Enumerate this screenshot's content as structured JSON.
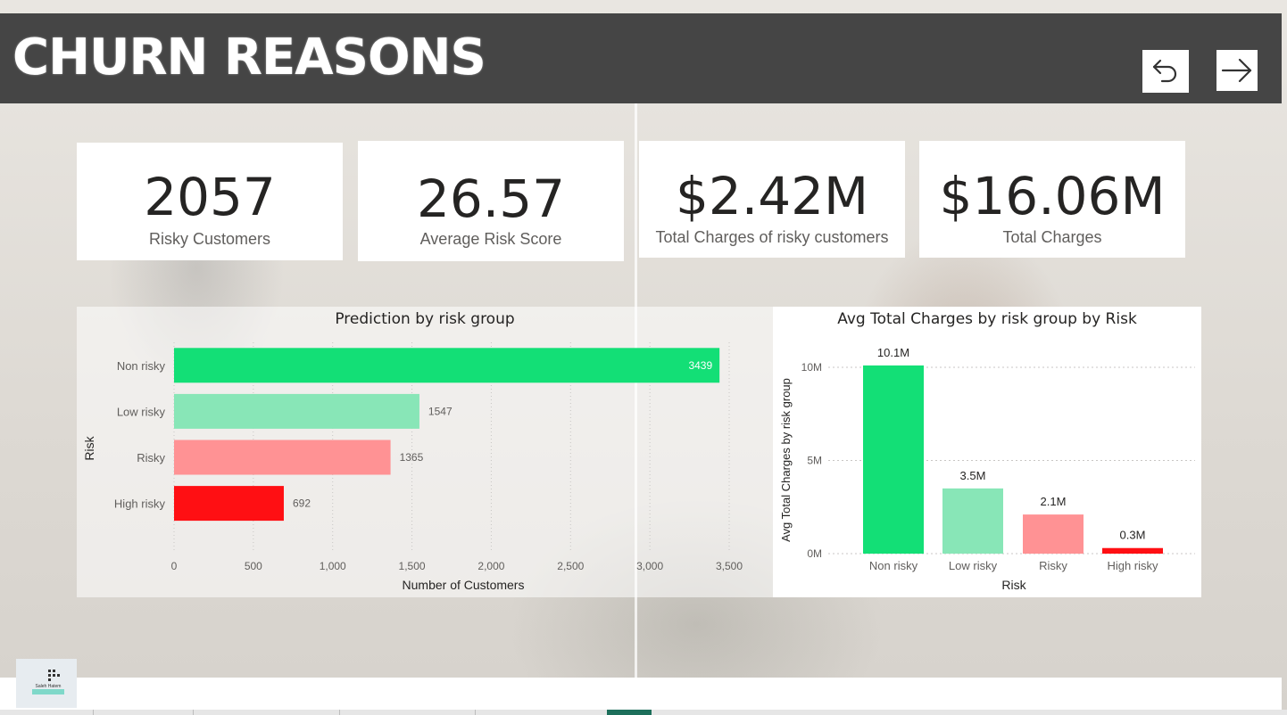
{
  "header": {
    "title": "CHURN REASONS",
    "back_icon": "undo-arrow-icon",
    "next_icon": "arrow-right-icon"
  },
  "kpis": [
    {
      "value": "2057",
      "label": "Risky Customers"
    },
    {
      "value": "26.57",
      "label": "Average Risk Score"
    },
    {
      "value": "$2.42M",
      "label": "Total Charges of risky customers"
    },
    {
      "value": "$16.06M",
      "label": "Total Charges"
    }
  ],
  "colors": {
    "non_risky": "#13df76",
    "low_risky": "#88e6b7",
    "risky": "#ff9294",
    "high_risky": "#ff0f13",
    "header_bg": "#454545"
  },
  "chart_data": [
    {
      "type": "bar",
      "orientation": "horizontal",
      "title": "Prediction by risk group",
      "xlabel": "Number of Customers",
      "ylabel": "Risk",
      "categories": [
        "Non risky",
        "Low risky",
        "Risky",
        "High risky"
      ],
      "values": [
        3439,
        1547,
        1365,
        692
      ],
      "value_labels": [
        "3439",
        "1547",
        "1365",
        "692"
      ],
      "xlim": [
        0,
        3500
      ],
      "xticks": [
        0,
        500,
        1000,
        1500,
        2000,
        2500,
        3000,
        3500
      ],
      "xtick_labels": [
        "0",
        "500",
        "1,000",
        "1,500",
        "2,000",
        "2,500",
        "3,000",
        "3,500"
      ],
      "grid": true
    },
    {
      "type": "bar",
      "orientation": "vertical",
      "title": "Avg Total Charges by risk group by Risk",
      "xlabel": "Risk",
      "ylabel": "Avg Total Charges by risk group",
      "categories": [
        "Non risky",
        "Low risky",
        "Risky",
        "High risky"
      ],
      "values": [
        10.1,
        3.5,
        2.1,
        0.3
      ],
      "value_labels": [
        "10.1M",
        "3.5M",
        "2.1M",
        "0.3M"
      ],
      "ylim": [
        0,
        10
      ],
      "yticks": [
        0,
        5,
        10
      ],
      "ytick_labels": [
        "0M",
        "5M",
        "10M"
      ],
      "grid": true
    }
  ],
  "footer": {
    "logo_text": "Saleh Hatem"
  }
}
